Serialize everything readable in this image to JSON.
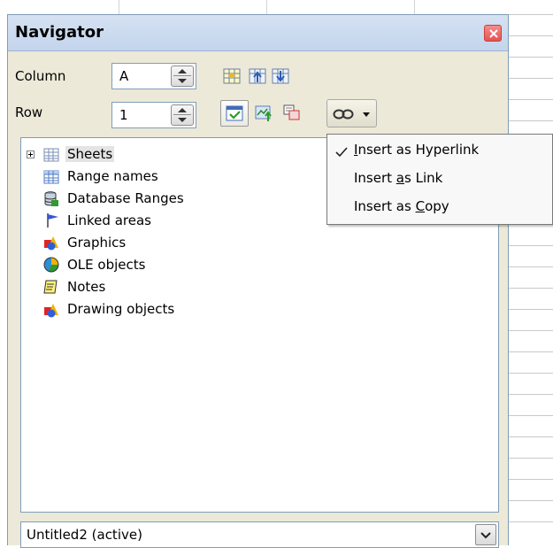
{
  "window": {
    "title": "Navigator"
  },
  "fields": {
    "column_label": "Column",
    "column_value": "A",
    "row_label": "Row",
    "row_value": "1"
  },
  "toolbar": {
    "icons": [
      "data-range-icon",
      "start-icon",
      "end-icon",
      "toggle-icon",
      "scenarios-icon",
      "drag-mode-icon",
      "insert-link-icon",
      "dropdown-arrow-icon"
    ]
  },
  "tree": {
    "items": [
      {
        "label": "Sheets",
        "icon": "sheet-icon"
      },
      {
        "label": "Range names",
        "icon": "range-icon"
      },
      {
        "label": "Database Ranges",
        "icon": "database-icon"
      },
      {
        "label": "Linked areas",
        "icon": "flag-icon"
      },
      {
        "label": "Graphics",
        "icon": "shapes-icon"
      },
      {
        "label": "OLE objects",
        "icon": "pie-icon"
      },
      {
        "label": "Notes",
        "icon": "note-icon"
      },
      {
        "label": "Drawing objects",
        "icon": "shapes-icon"
      }
    ]
  },
  "document_select": {
    "value": "Untitled2 (active)"
  },
  "menu": {
    "items": [
      {
        "prefix": "",
        "mnemonic": "I",
        "suffix": "nsert as Hyperlink",
        "checked": true
      },
      {
        "prefix": "Insert ",
        "mnemonic": "a",
        "suffix": "s Link",
        "checked": false
      },
      {
        "prefix": "Insert as ",
        "mnemonic": "C",
        "suffix": "opy",
        "checked": false
      }
    ]
  },
  "colors": {
    "title_bar": "#c3d4ec",
    "window_bg": "#ece9d8",
    "close": "#e5534f"
  }
}
